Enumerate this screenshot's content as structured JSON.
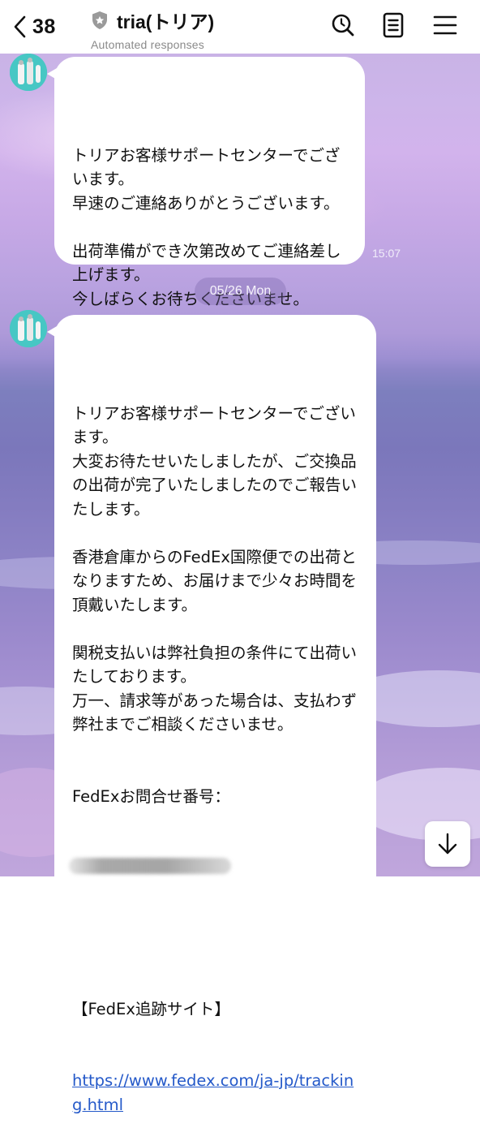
{
  "header": {
    "back_count": "38",
    "title": "tria(トリア)",
    "subtitle": "Automated responses"
  },
  "messages": [
    {
      "text": "トリアお客様サポートセンターでございます。\n早速のご連絡ありがとうございます。\n\n出荷準備ができ次第改めてご連絡差し上げます。\n今しばらくお待ちくださいませ。",
      "time": "15:07"
    },
    {
      "text": "トリアお客様サポートセンターでございます。\n大変お待たせいたしましたが、ご交換品の出荷が完了いたしましたのでご報告いたします。\n\n香港倉庫からのFedEx国際便での出荷となりますため、お届けまで少々お時間を頂戴いたします。\n\n関税支払いは弊社負担の条件にて出荷いたしております。\n万一、請求等があった場合は、支払わず弊社までご相談くださいませ。\n\n\nFedExお問合せ番号：",
      "text_after": "【FedEx追跡サイト】",
      "link": "https://www.fedex.com/ja-jp/tracking.html"
    }
  ],
  "date_separator": "05/26 Mon",
  "colors": {
    "link": "#2459c9",
    "avatar": "#47c7c4",
    "bubble": "#ffffff"
  },
  "icons": [
    "back-chevron-icon",
    "verified-shield-icon",
    "search-icon",
    "notes-icon",
    "menu-icon",
    "arrow-down-icon"
  ]
}
